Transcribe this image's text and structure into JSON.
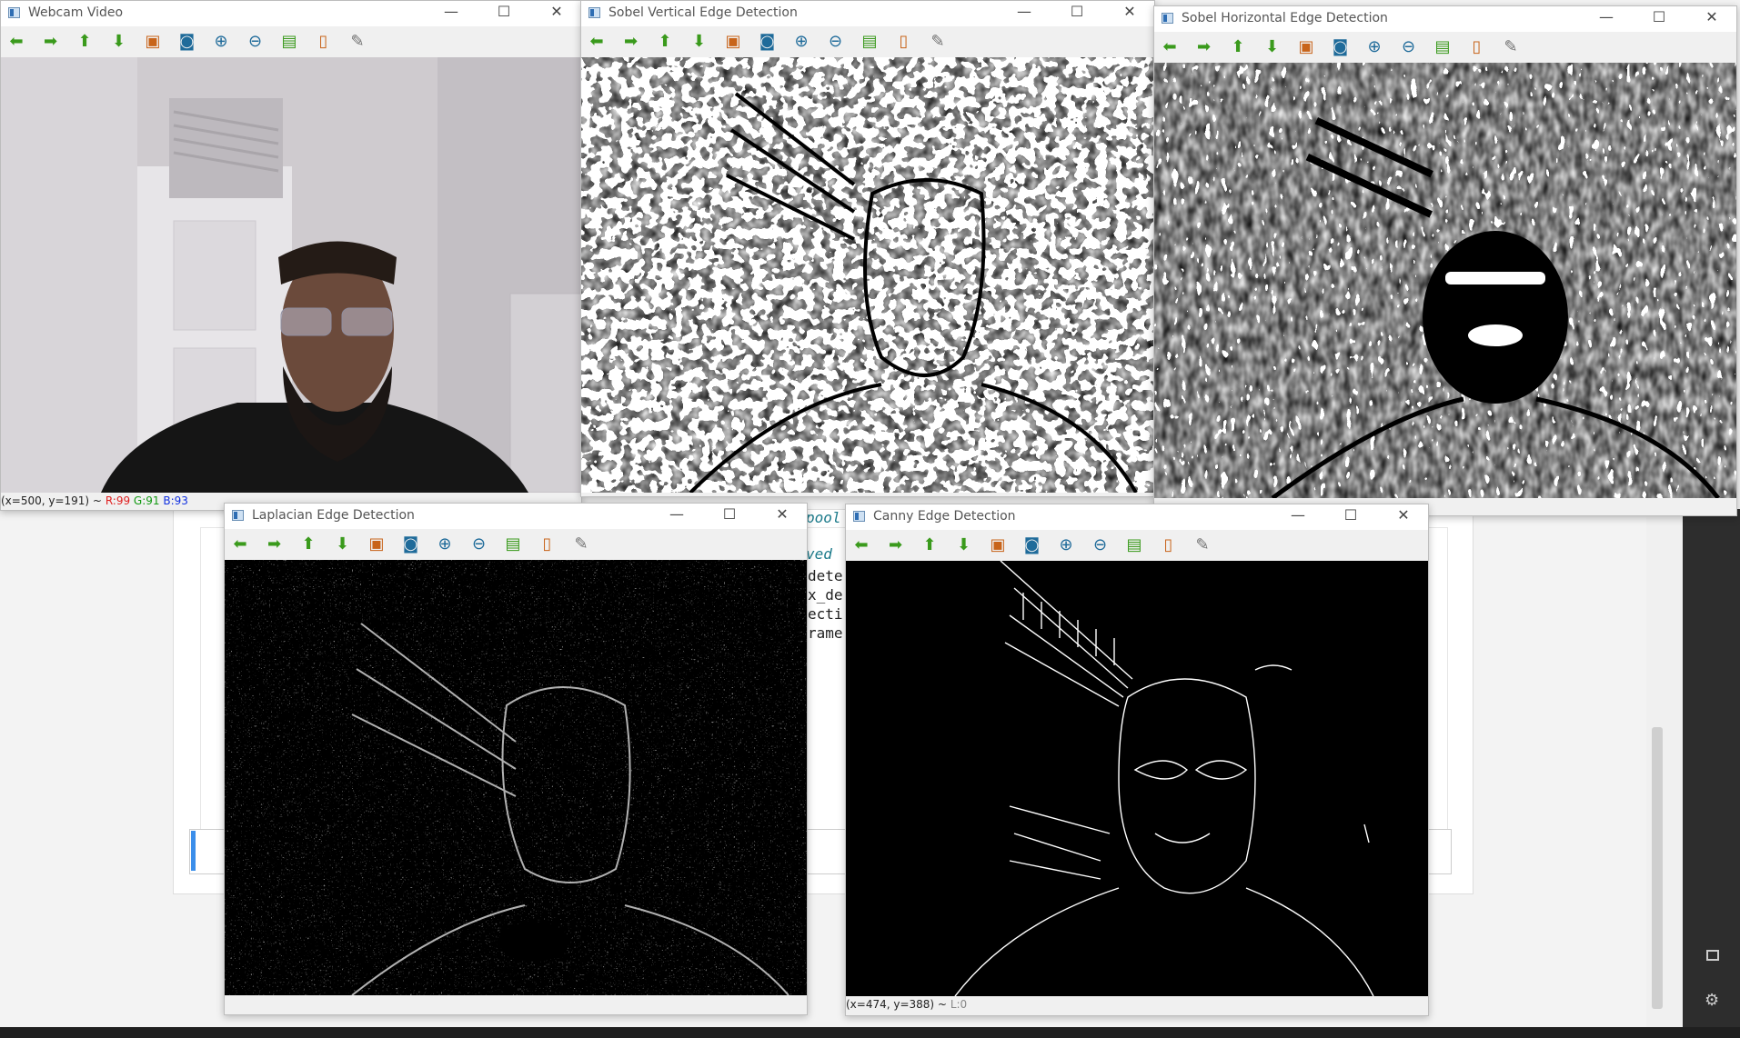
{
  "background_editor": {
    "code_fragments": [
      "pool",
      "ved",
      "dete",
      "x_de",
      "ecti",
      "rame"
    ]
  },
  "toolbar_icons": [
    {
      "name": "pan-left-icon",
      "glyph": "⬅",
      "cls": "g"
    },
    {
      "name": "pan-right-icon",
      "glyph": "➡",
      "cls": "g"
    },
    {
      "name": "pan-up-icon",
      "glyph": "⬆",
      "cls": "g"
    },
    {
      "name": "pan-down-icon",
      "glyph": "⬇",
      "cls": "g"
    },
    {
      "name": "zoom-to-fit-icon",
      "glyph": "▣",
      "cls": "o"
    },
    {
      "name": "zoom-original-icon",
      "glyph": "◙",
      "cls": "b"
    },
    {
      "name": "zoom-in-icon",
      "glyph": "⊕",
      "cls": "b"
    },
    {
      "name": "zoom-out-icon",
      "glyph": "⊖",
      "cls": "b"
    },
    {
      "name": "save-icon",
      "glyph": "▤",
      "cls": "g"
    },
    {
      "name": "copy-clipboard-icon",
      "glyph": "▯",
      "cls": "o"
    },
    {
      "name": "properties-icon",
      "glyph": "✎",
      "cls": "gr"
    }
  ],
  "windows": {
    "webcam": {
      "title": "Webcam Video",
      "status": {
        "coords": "(x=500, y=191) ~",
        "r": "R:99",
        "g": "G:91",
        "b": "B:93"
      }
    },
    "sobel_vertical": {
      "title": "Sobel Vertical Edge Detection"
    },
    "sobel_horizontal": {
      "title": "Sobel Horizontal Edge Detection"
    },
    "laplacian": {
      "title": "Laplacian Edge Detection"
    },
    "canny": {
      "title": "Canny Edge Detection",
      "status": {
        "coords": "(x=474, y=388) ~",
        "l": "L:0"
      }
    }
  },
  "title_controls": {
    "minimize": "—",
    "maximize": "☐",
    "close": "✕"
  }
}
